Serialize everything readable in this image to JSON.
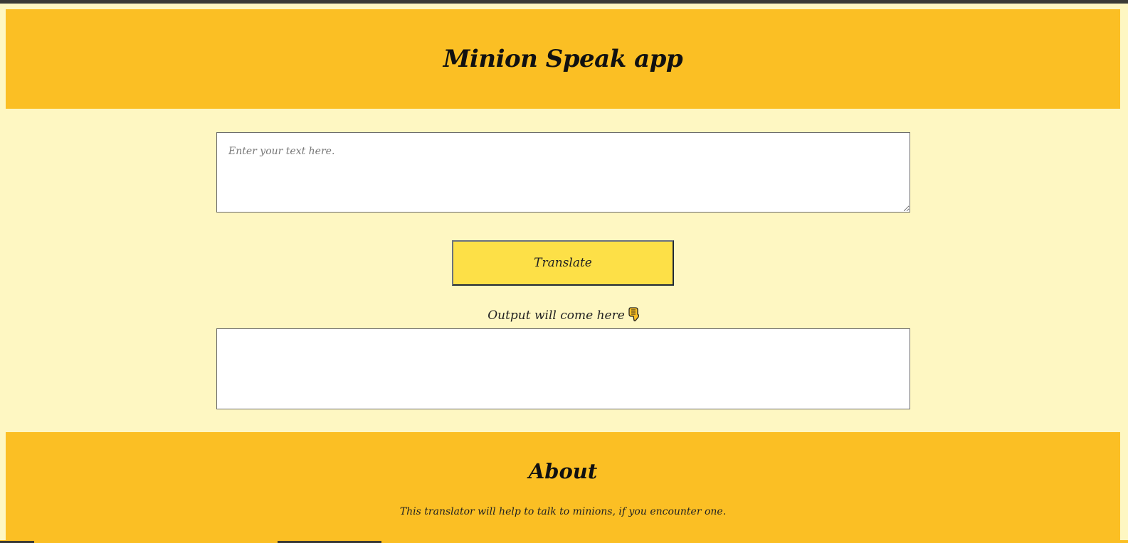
{
  "header": {
    "title": "Minion Speak app"
  },
  "translator": {
    "input_placeholder": "Enter your text here.",
    "input_value": "",
    "translate_label": "Translate",
    "output_label": "Output will come here",
    "output_value": ""
  },
  "about": {
    "title": "About",
    "description": "This translator will help to talk to minions, if you encounter one."
  },
  "icons": {
    "output_pointer": "pointing-down-hand-icon"
  },
  "colors": {
    "accent": "#fbbf24",
    "background": "#fef7c2",
    "button": "#fde047"
  }
}
